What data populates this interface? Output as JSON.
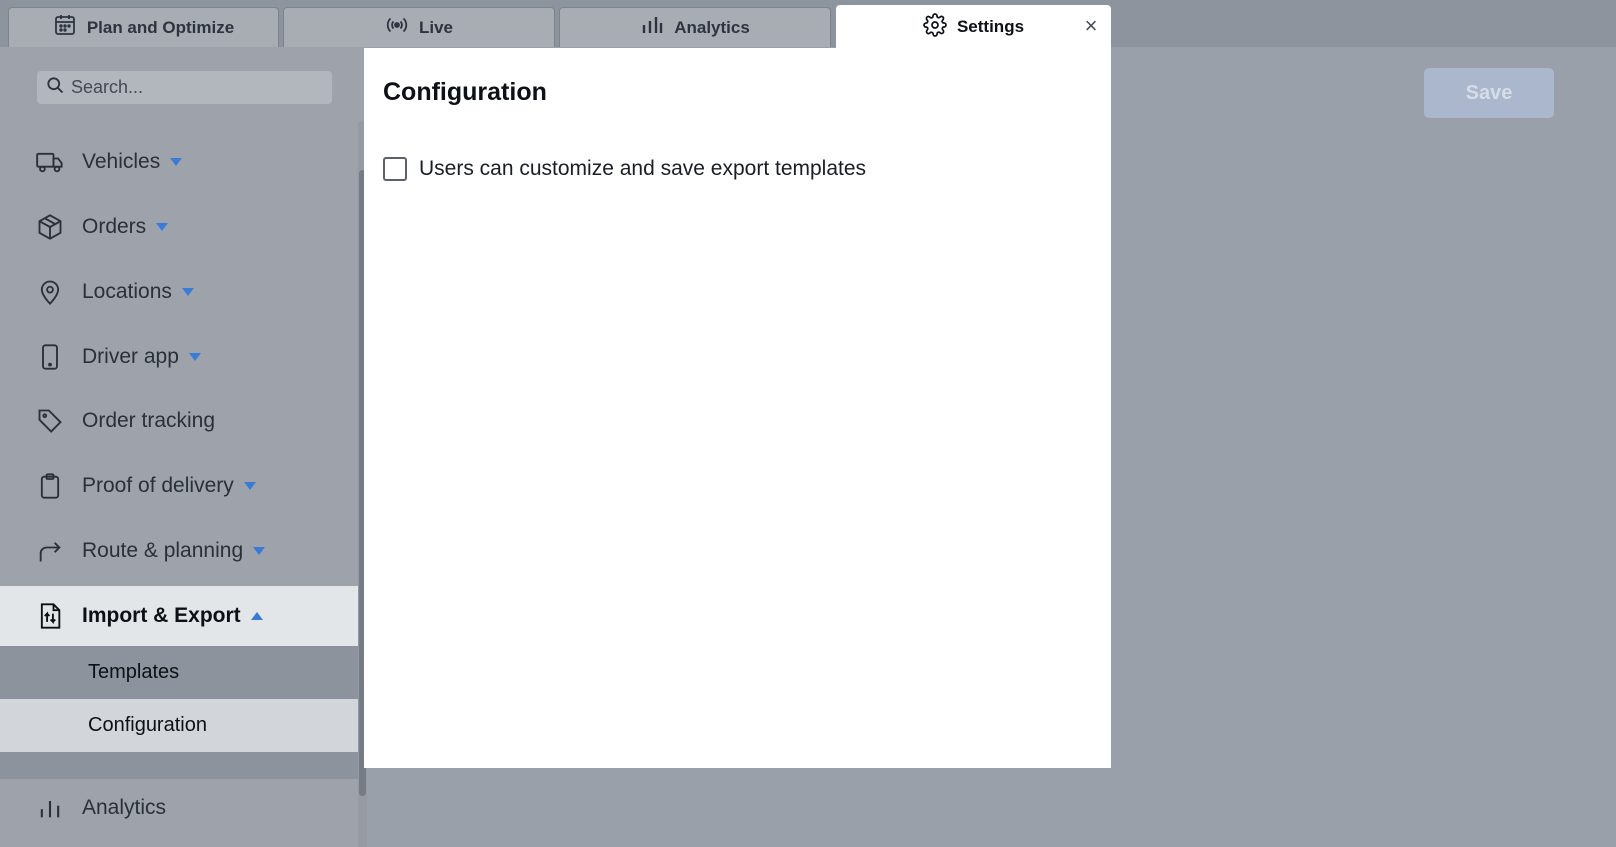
{
  "tabs": [
    {
      "label": "Plan and Optimize",
      "icon": "calendar-icon"
    },
    {
      "label": "Live",
      "icon": "broadcast-icon"
    },
    {
      "label": "Analytics",
      "icon": "bar-chart-icon"
    },
    {
      "label": "Settings",
      "icon": "gear-icon",
      "active": true
    }
  ],
  "close_symbol": "×",
  "search": {
    "placeholder": "Search..."
  },
  "sidebar": {
    "items": [
      {
        "label": "Vehicles",
        "icon": "truck-icon",
        "caret": "down"
      },
      {
        "label": "Orders",
        "icon": "package-icon",
        "caret": "down"
      },
      {
        "label": "Locations",
        "icon": "map-pin-icon",
        "caret": "down"
      },
      {
        "label": "Driver app",
        "icon": "smartphone-icon",
        "caret": "down"
      },
      {
        "label": "Order tracking",
        "icon": "tag-icon",
        "caret": "none"
      },
      {
        "label": "Proof of delivery",
        "icon": "clipboard-icon",
        "caret": "down"
      },
      {
        "label": "Route & planning",
        "icon": "route-arrow-icon",
        "caret": "down"
      },
      {
        "label": "Import & Export",
        "icon": "import-export-icon",
        "caret": "up",
        "expanded": true
      },
      {
        "label": "Analytics",
        "icon": "bar-chart-icon",
        "caret": "none"
      }
    ],
    "sub_items": [
      {
        "label": "Templates"
      },
      {
        "label": "Configuration",
        "active": true
      }
    ]
  },
  "modal": {
    "title": "Configuration",
    "option_label": "Users can customize and save export templates",
    "option_checked": false
  },
  "toolbar": {
    "save_label": "Save"
  },
  "colors": {
    "accent": "#3a7bd5",
    "save_disabled": "#aab7cc"
  }
}
